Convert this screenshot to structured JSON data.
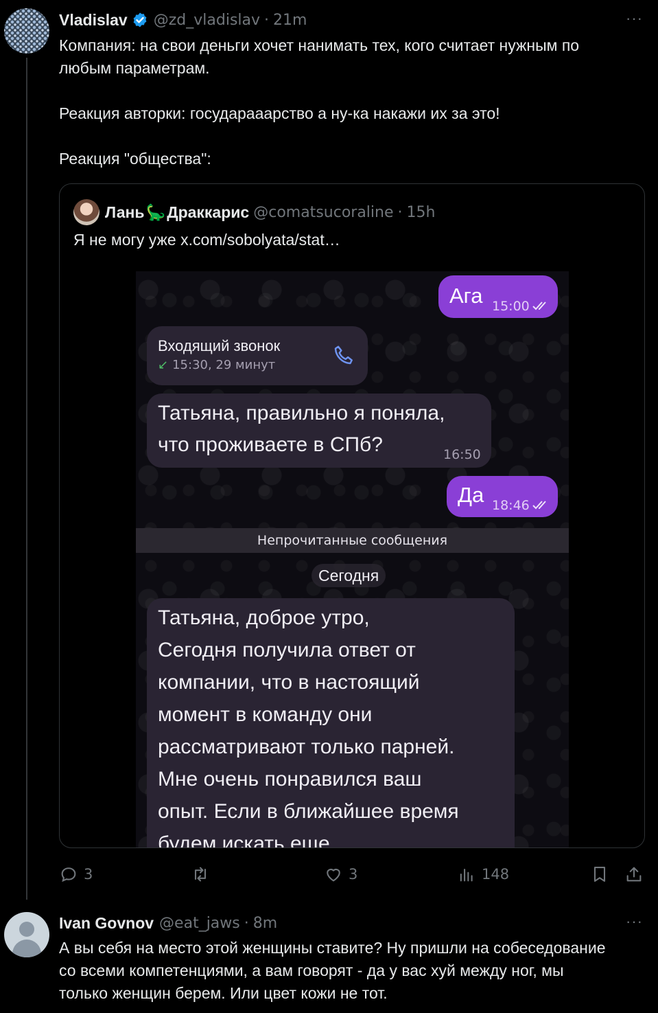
{
  "tweet": {
    "author_name": "Vladislav",
    "handle": "@zd_vladislav",
    "time": "21m",
    "more": "···",
    "text_lines": [
      "Компания: на свои деньги хочет нанимать тех, кого считает нужным по",
      "любым параметрам.",
      "Реакция авторки: государааарство а ну-ка накажи их за это!",
      "Реакция \"общества\":"
    ],
    "actions": {
      "replies": "3",
      "retweets": "",
      "likes": "3",
      "views": "148"
    }
  },
  "quote": {
    "author_name_part1": "Лань",
    "author_name_emoji": "🦕",
    "author_name_part2": "Драккарис",
    "handle": "@comatsucoraline",
    "time": "15h",
    "text": "Я не могу уже  x.com/sobolyata/stat…",
    "chat": {
      "msg_out_1": {
        "text": "Ага",
        "time": "15:00"
      },
      "call": {
        "title": "Входящий звонок",
        "arrow": "↙",
        "subtitle": "15:30, 29 минут"
      },
      "msg_in_1": {
        "lines": [
          "Татьяна, правильно я поняла,",
          "что проживаете в СПб?"
        ],
        "time": "16:50"
      },
      "msg_out_2": {
        "text": "Да",
        "time": "18:46"
      },
      "unread_label": "Непрочитанные сообщения",
      "date_label": "Сегодня",
      "msg_in_2": {
        "lines": [
          "Татьяна, доброе утро,",
          "Сегодня получила ответ от",
          "компании, что в настоящий",
          "момент в команду они",
          "рассматривают только парней.",
          "Мне очень понравился ваш",
          "опыт. Если в ближайшее время",
          "будем искать еще"
        ]
      }
    }
  },
  "reply": {
    "author_name": "Ivan Govnov",
    "handle": "@eat_jaws",
    "time": "8m",
    "more": "···",
    "text_lines": [
      "А вы себя на место этой женщины ставите? Ну пришли на собеседование",
      "со всеми компетенциями, а вам говорят - да у вас хуй между ног, мы",
      "только женщин берем. Или цвет кожи не тот."
    ]
  },
  "colors": {
    "background": "#000000",
    "text": "#e7e9ea",
    "muted": "#71767b",
    "verified": "#1d9bf0",
    "bubble_out": "#8a3fd6",
    "bubble_in": "#2a2433"
  },
  "icons": [
    "verified-badge-icon",
    "more-icon",
    "reply-icon",
    "retweet-icon",
    "like-icon",
    "views-icon",
    "bookmark-icon",
    "share-icon",
    "phone-icon",
    "double-check-icon",
    "incoming-arrow-icon",
    "dinosaur-emoji"
  ]
}
